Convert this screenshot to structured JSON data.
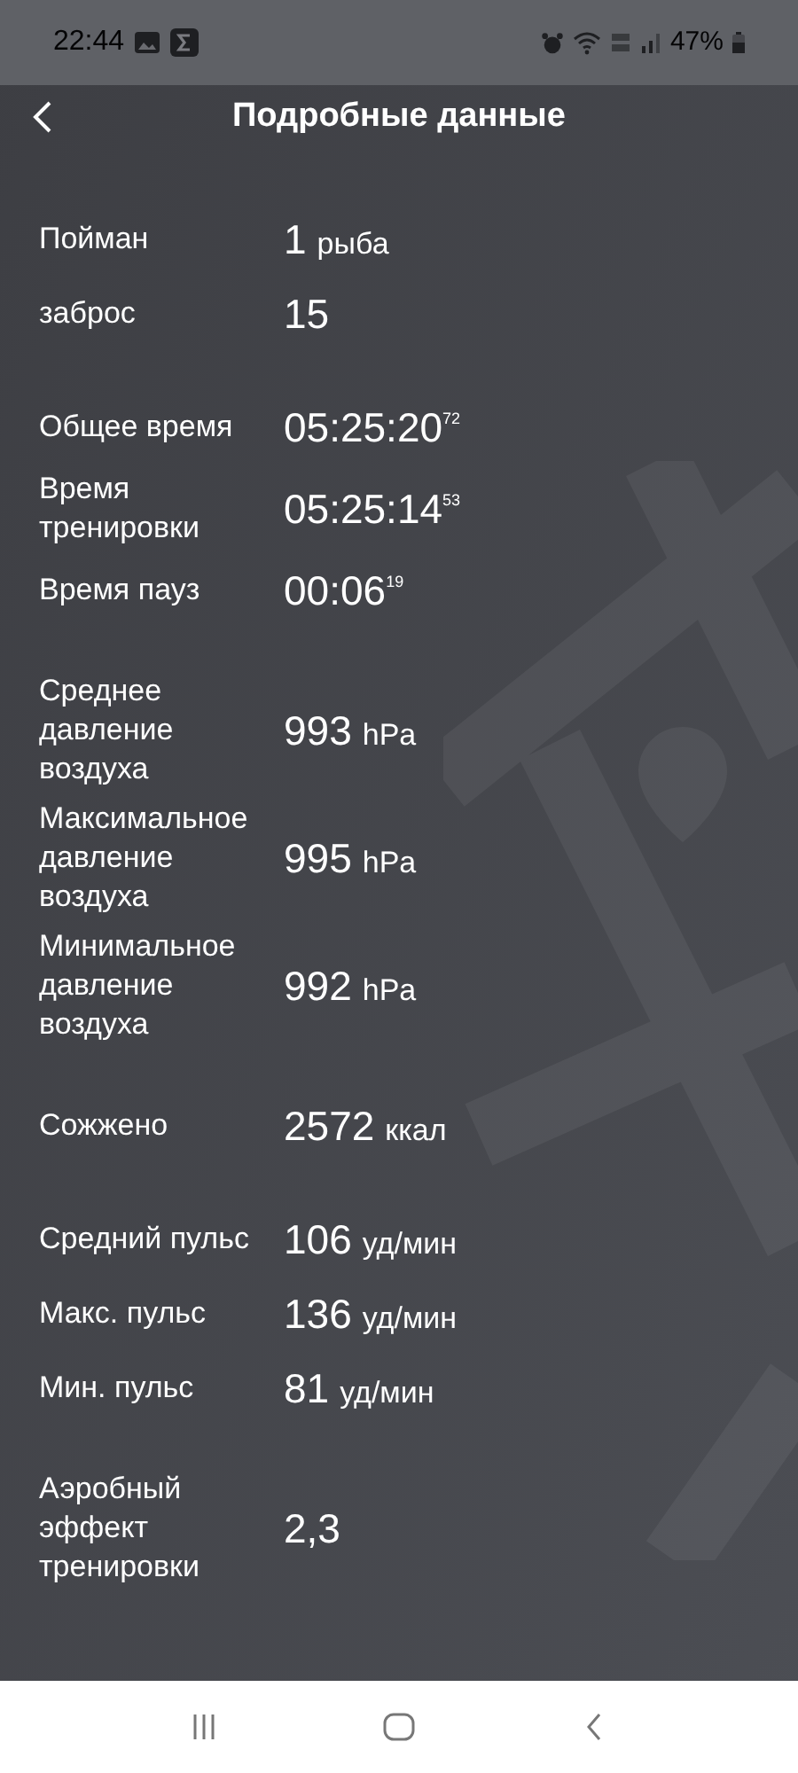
{
  "status_bar": {
    "time": "22:44",
    "battery": "47%"
  },
  "header": {
    "title": "Подробные данные"
  },
  "groups": [
    {
      "rows": [
        {
          "label": "Пойман",
          "value": "1",
          "unit": "рыба"
        },
        {
          "label": "заброс",
          "value": "15"
        }
      ]
    },
    {
      "rows": [
        {
          "label": "Общее время",
          "value": "05:25:20",
          "fraction": "72"
        },
        {
          "label": "Время тренировки",
          "value": "05:25:14",
          "fraction": "53"
        },
        {
          "label": "Время пауз",
          "value": "00:06",
          "fraction": "19"
        }
      ]
    },
    {
      "rows": [
        {
          "label": "Среднее давление воздуха",
          "value": "993",
          "unit": "hPa"
        },
        {
          "label": "Максимальное давление воздуха",
          "value": "995",
          "unit": "hPa"
        },
        {
          "label": "Минимальное давление воздуха",
          "value": "992",
          "unit": "hPa"
        }
      ]
    },
    {
      "rows": [
        {
          "label": "Сожжено",
          "value": "2572",
          "unit": "ккал"
        }
      ]
    },
    {
      "rows": [
        {
          "label": "Средний пульс",
          "value": "106",
          "unit": "уд/мин"
        },
        {
          "label": "Макс. пульс",
          "value": "136",
          "unit": "уд/мин"
        },
        {
          "label": "Мин. пульс",
          "value": "81",
          "unit": "уд/мин"
        }
      ]
    },
    {
      "rows": [
        {
          "label": "Аэробный эффект тренировки",
          "value": "2,3"
        }
      ]
    }
  ]
}
